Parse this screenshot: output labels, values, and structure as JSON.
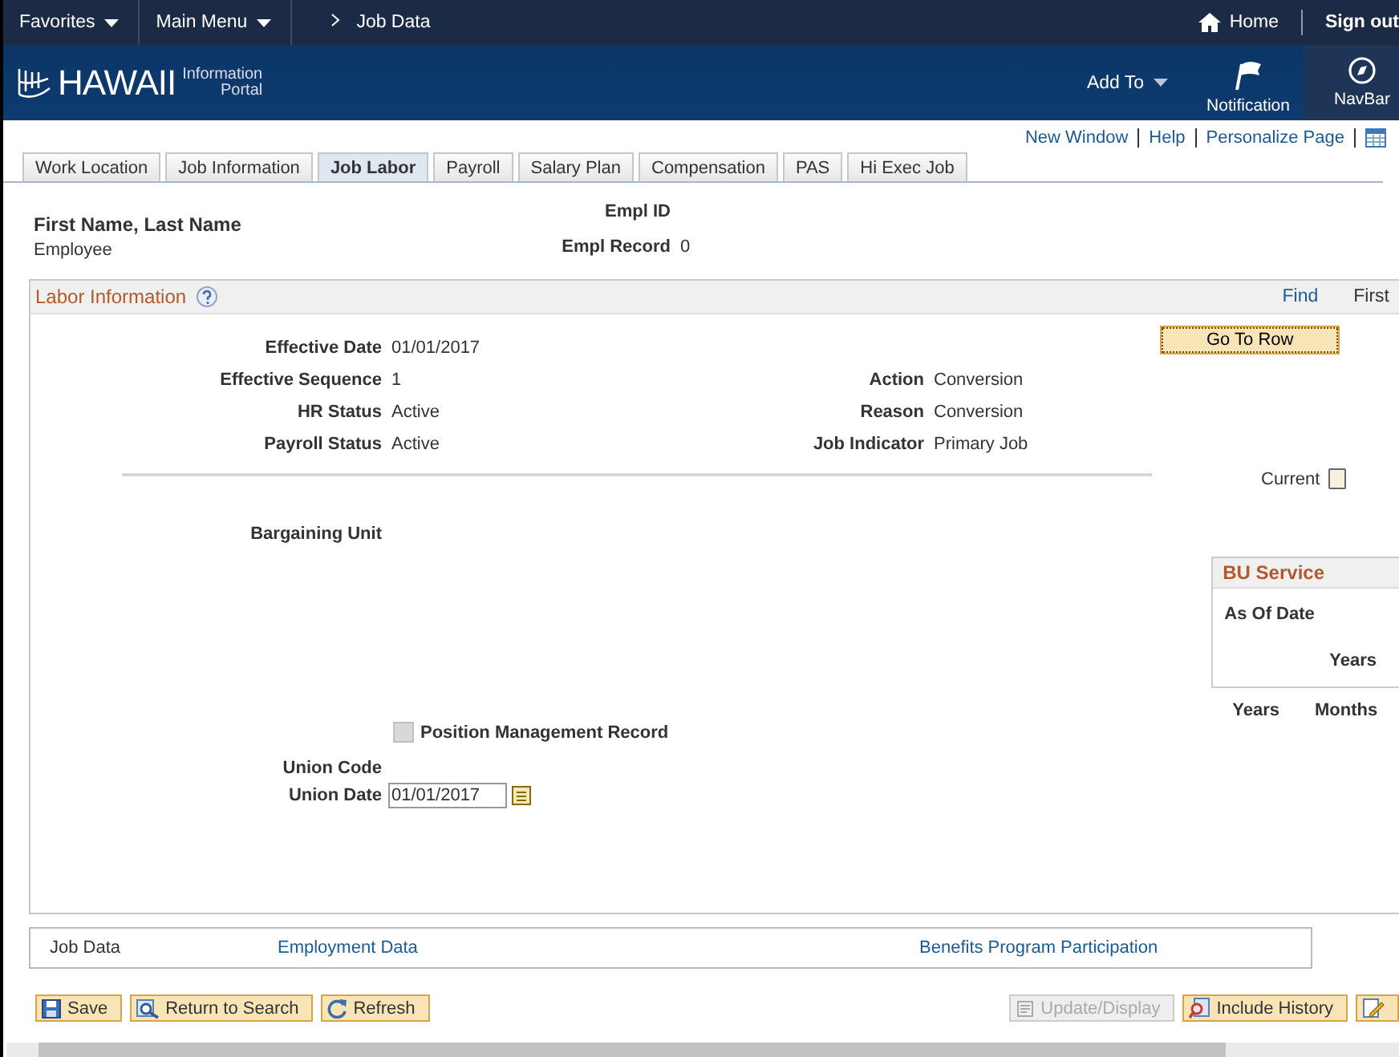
{
  "top_bar": {
    "menus": [
      "Favorites",
      "Main Menu"
    ],
    "breadcrumb": "Job Data",
    "home": "Home",
    "sign_out": "Sign out"
  },
  "banner": {
    "logo_main": "HAWAII",
    "logo_sub_1": "Information",
    "logo_sub_2": "Portal",
    "add_to": "Add To",
    "notification": "Notification",
    "navbar": "NavBar"
  },
  "page_links": [
    "New Window",
    "Help",
    "Personalize Page"
  ],
  "tabs": [
    {
      "label": "Work Location",
      "selected": false
    },
    {
      "label": "Job Information",
      "selected": false
    },
    {
      "label": "Job Labor",
      "selected": true
    },
    {
      "label": "Payroll",
      "selected": false
    },
    {
      "label": "Salary Plan",
      "selected": false
    },
    {
      "label": "Compensation",
      "selected": false
    },
    {
      "label": "PAS",
      "selected": false
    },
    {
      "label": "Hi Exec Job",
      "selected": false
    }
  ],
  "employee": {
    "name": "First Name, Last Name",
    "role": "Employee",
    "empl_id_label": "Empl ID",
    "empl_record_label": "Empl Record",
    "empl_record": "0"
  },
  "labor_information": {
    "title": "Labor Information",
    "find": "Find",
    "first": "First",
    "go_to_row": "Go To Row",
    "fields": [
      {
        "label": "Effective Date",
        "value": "01/01/2017"
      },
      {
        "label": "Effective Sequence",
        "value": "1",
        "right_label": "Action",
        "right_value": "Conversion"
      },
      {
        "label": "HR Status",
        "value": "Active",
        "right_label": "Reason",
        "right_value": "Conversion"
      },
      {
        "label": "Payroll Status",
        "value": "Active",
        "right_label": "Job Indicator",
        "right_value": "Primary Job"
      }
    ],
    "current": {
      "label": "Current",
      "checked": false
    },
    "bargaining_unit_label": "Bargaining Unit",
    "bu_service": {
      "title": "BU Service",
      "as_of_date": "As Of Date",
      "years": "Years"
    },
    "years": "Years",
    "months": "Months",
    "position_management_record": {
      "label": "Position Management Record",
      "checked": false,
      "disabled": true
    },
    "union_code_label": "Union Code",
    "union_date": {
      "label": "Union Date",
      "value": "01/01/2017"
    }
  },
  "footer_links": [
    {
      "label": "Job Data",
      "kind": "text"
    },
    {
      "label": "Employment Data",
      "kind": "link"
    },
    {
      "label": "Benefits Program Participation",
      "kind": "link"
    }
  ],
  "toolbar": [
    {
      "label": "Save",
      "kind": "save",
      "disabled": false
    },
    {
      "label": "Return to Search",
      "kind": "search",
      "disabled": false
    },
    {
      "label": "Refresh",
      "kind": "refresh",
      "disabled": false
    },
    {
      "label": "Update/Display",
      "kind": "update",
      "disabled": true
    },
    {
      "label": "Include History",
      "kind": "history",
      "disabled": false
    },
    {
      "kind": "edit",
      "disabled": false
    }
  ]
}
